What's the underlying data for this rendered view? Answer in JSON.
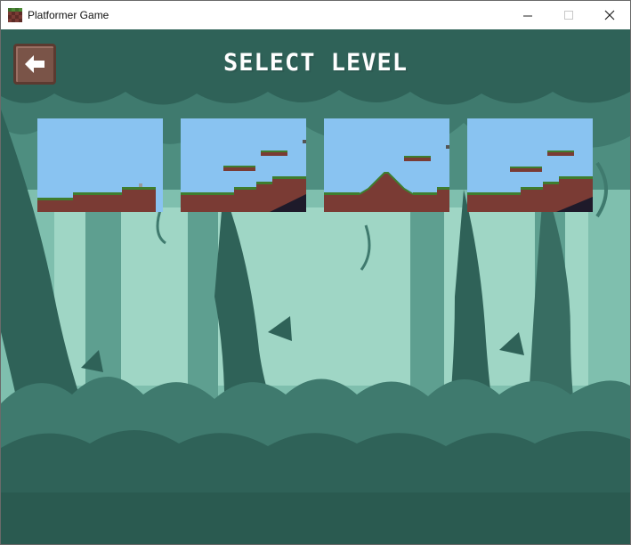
{
  "window": {
    "title": "Platformer Game",
    "controls": {
      "minimize": "—",
      "maximize": "☐",
      "close": "✕"
    }
  },
  "game": {
    "heading": "SELECT LEVEL",
    "back_button": {
      "icon": "arrow-left-icon"
    },
    "levels": [
      {
        "icon": "level-1-thumbnail"
      },
      {
        "icon": "level-2-thumbnail"
      },
      {
        "icon": "level-3-thumbnail"
      },
      {
        "icon": "level-4-thumbnail"
      }
    ]
  },
  "colors": {
    "sky": "#89c3f1",
    "dirt": "#7a3b34",
    "grass": "#3f7d2e",
    "forest_dark": "#2d5a52",
    "forest_mid": "#4e8e80",
    "forest_light": "#a8dccb",
    "button": "#7a5448"
  }
}
